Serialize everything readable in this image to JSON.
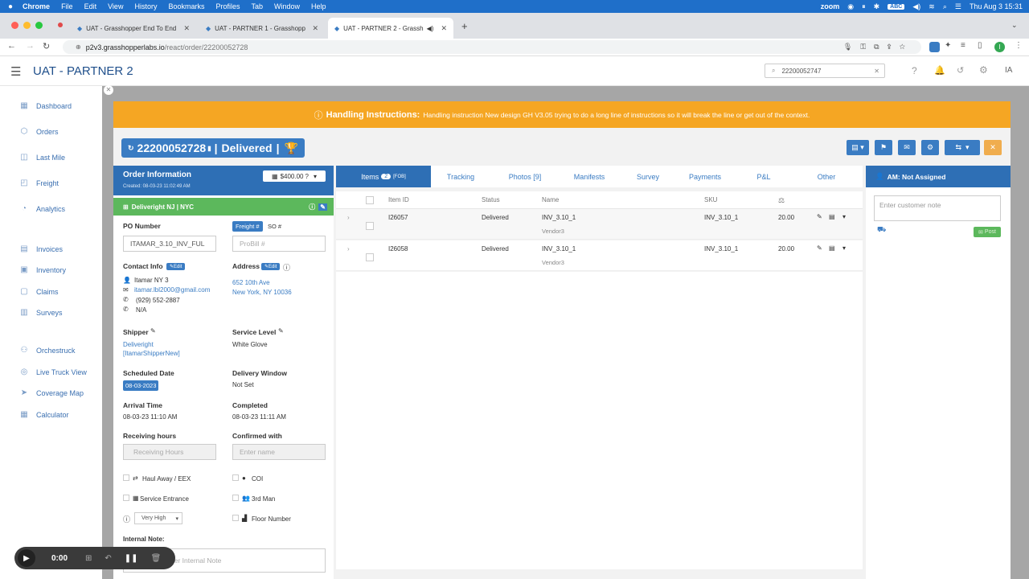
{
  "macbar": {
    "apple": "",
    "menus": [
      "Chrome",
      "File",
      "Edit",
      "View",
      "History",
      "Bookmarks",
      "Profiles",
      "Tab",
      "Window",
      "Help"
    ],
    "zoom": "zoom",
    "keyboard": "ABC",
    "datetime": "Thu Aug 3  15:31"
  },
  "browser": {
    "tabs": [
      {
        "label": "UAT - Grasshopper End To End"
      },
      {
        "label": "UAT - PARTNER 1 - Grasshopp"
      },
      {
        "label": "UAT - PARTNER 2 - Grassh"
      }
    ],
    "new_tab": "+",
    "url_host": "p2v3.grasshopperlabs.io",
    "url_path": "/react/order/22200052728",
    "profile_initial": "I"
  },
  "app": {
    "title": "UAT - PARTNER 2",
    "search_value": "22200052747",
    "user_initials": "IA"
  },
  "sidebar": {
    "items": [
      {
        "label": "Dashboard",
        "icon": "dashboard-icon"
      },
      {
        "label": "Orders",
        "icon": "orders-icon"
      },
      {
        "label": "Last Mile",
        "icon": "last-mile-icon"
      },
      {
        "label": "Freight",
        "icon": "freight-icon"
      },
      {
        "label": "Analytics",
        "icon": "analytics-icon"
      },
      {
        "label": "Invoices",
        "icon": "invoices-icon"
      },
      {
        "label": "Inventory",
        "icon": "inventory-icon"
      },
      {
        "label": "Claims",
        "icon": "claims-icon"
      },
      {
        "label": "Surveys",
        "icon": "surveys-icon"
      },
      {
        "label": "Orchestruck",
        "icon": "orchestruck-icon"
      },
      {
        "label": "Live Truck View",
        "icon": "live-truck-icon"
      },
      {
        "label": "Coverage Map",
        "icon": "coverage-map-icon"
      },
      {
        "label": "Calculator",
        "icon": "calculator-icon"
      }
    ]
  },
  "handling": {
    "label": "Handling Instructions:",
    "text": "Handling instruction New design GH V3.05 trying to do a long line of instructions so it will break the line or get out of the context."
  },
  "order": {
    "title": "22200052728",
    "separator1": "|",
    "status": "Delivered",
    "separator2": "|"
  },
  "order_info": {
    "title": "Order Information",
    "created": "Created: 08-03-23 11:02:49 AM",
    "price": "$400.00",
    "carrier": "Deliveright NJ | NYC",
    "po_label": "PO Number",
    "po_value": "ITAMAR_3.10_INV_FUL",
    "freight_pill": "Freight #",
    "so_pill": "SO #",
    "probill_placeholder": "ProBill #",
    "contact_label": "Contact Info",
    "edit": "Edit",
    "contact_name": "Itamar NY 3",
    "contact_email": "itamar.lbl2000@gmail.com",
    "contact_phone": "(929) 552-2887",
    "contact_na": "N/A",
    "address_label": "Address",
    "address_line1": "652 10th Ave",
    "address_line2": "New York, NY 10036",
    "shipper_label": "Shipper",
    "shipper_line1": "Deliveright",
    "shipper_line2": "[ItamarShipperNew]",
    "service_label": "Service Level",
    "service_value": "White Glove",
    "scheduled_label": "Scheduled Date",
    "scheduled_value": "08-03-2023",
    "window_label": "Delivery Window",
    "window_value": "Not Set",
    "arrival_label": "Arrival Time",
    "arrival_value": "08-03-23 11:10 AM",
    "completed_label": "Completed",
    "completed_value": "08-03-23 11:11 AM",
    "receiving_label": "Receiving hours",
    "receiving_placeholder": "Receiving Hours",
    "confirmed_label": "Confirmed with",
    "confirmed_placeholder": "Enter name",
    "haul_away": "Haul Away / EEX",
    "coi": "COI",
    "service_entrance": "Service Entrance",
    "third_man": "3rd Man",
    "priority": "Very High",
    "floor_number": "Floor Number",
    "internal_note_label": "Internal Note:",
    "internal_note_placeholder": "Enter Internal Note"
  },
  "center_tabs": [
    {
      "label": "Items",
      "badge": "2",
      "tag": "FOB"
    },
    {
      "label": "Tracking"
    },
    {
      "label": "Photos [9]"
    },
    {
      "label": "Manifests"
    },
    {
      "label": "Survey"
    },
    {
      "label": "Payments"
    },
    {
      "label": "P&L"
    },
    {
      "label": "Other"
    }
  ],
  "grid": {
    "columns": [
      "Item ID",
      "Status",
      "Name",
      "SKU"
    ],
    "rows": [
      {
        "id": "I26057",
        "status": "Delivered",
        "name": "INV_3.10_1",
        "vendor": "Vendor3",
        "sku": "INV_3.10_1",
        "qty": "20.00"
      },
      {
        "id": "I26058",
        "status": "Delivered",
        "name": "INV_3.10_1",
        "vendor": "Vendor3",
        "sku": "INV_3.10_1",
        "qty": "20.00"
      }
    ]
  },
  "am": {
    "title": "AM: Not Assigned",
    "note_placeholder": "Enter customer note",
    "post": "Post"
  },
  "recorder": {
    "time": "0:00"
  },
  "colors": {
    "primary": "#2e6fb5",
    "handling": "#f5a623",
    "success": "#5cb85c",
    "close": "#f0ad4e"
  }
}
